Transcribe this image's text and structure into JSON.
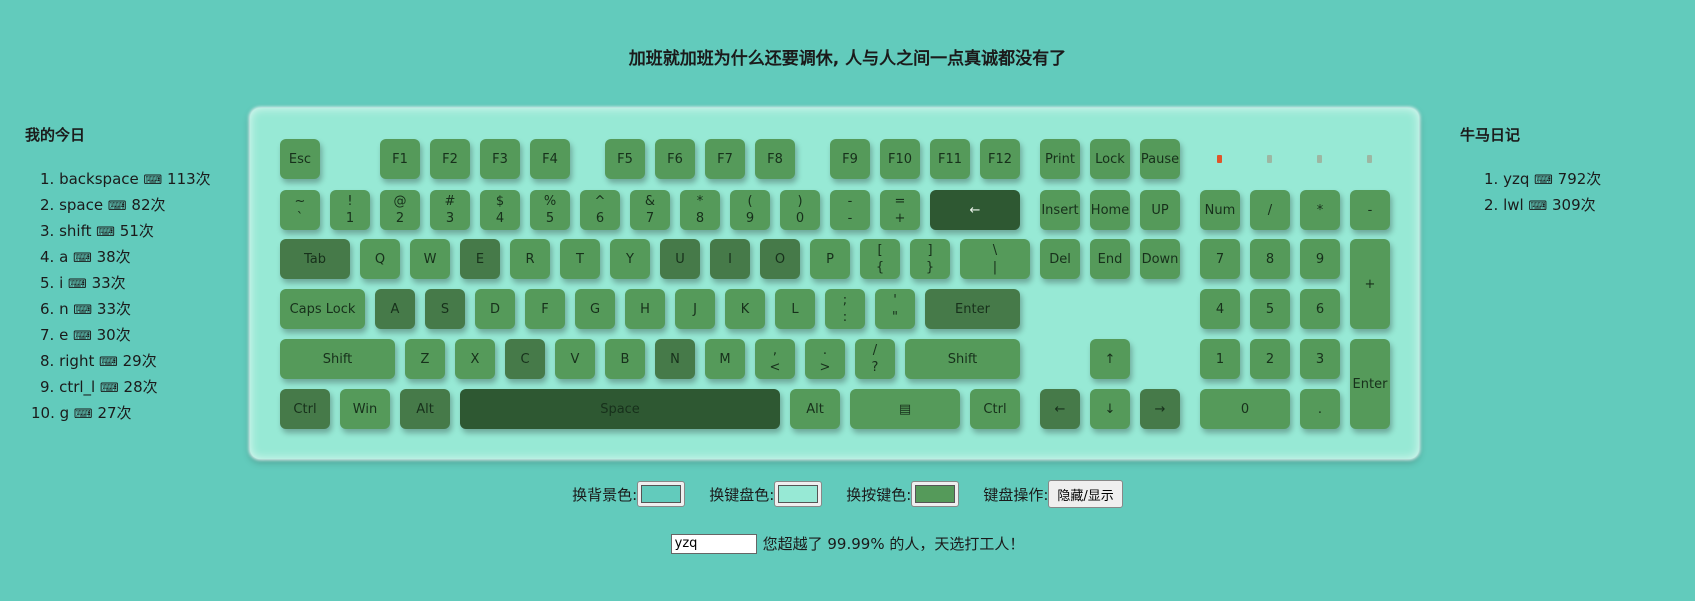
{
  "title": "加班就加班为什么还要调休, 人与人之间一点真诚都没有了",
  "left_panel": {
    "title": "我的今日",
    "items": [
      {
        "num": "1.",
        "key": "backspace",
        "count": "113次"
      },
      {
        "num": "2.",
        "key": "space",
        "count": "82次"
      },
      {
        "num": "3.",
        "key": "shift",
        "count": "51次"
      },
      {
        "num": "4.",
        "key": "a",
        "count": "38次"
      },
      {
        "num": "5.",
        "key": "i",
        "count": "33次"
      },
      {
        "num": "6.",
        "key": "n",
        "count": "33次"
      },
      {
        "num": "7.",
        "key": "e",
        "count": "30次"
      },
      {
        "num": "8.",
        "key": "right",
        "count": "29次"
      },
      {
        "num": "9.",
        "key": "ctrl_l",
        "count": "28次"
      },
      {
        "num": "10.",
        "key": "g",
        "count": "27次"
      }
    ]
  },
  "right_panel": {
    "title": "牛马日记",
    "items": [
      {
        "num": "1.",
        "key": "yzq",
        "count": "792次"
      },
      {
        "num": "2.",
        "key": "lwl",
        "count": "309次"
      }
    ]
  },
  "icons": {
    "keyboard": "⌨",
    "menu": "▤"
  },
  "keys": {
    "esc": "Esc",
    "f": [
      "F1",
      "F2",
      "F3",
      "F4",
      "F5",
      "F6",
      "F7",
      "F8",
      "F9",
      "F10",
      "F11",
      "F12"
    ],
    "print": "Print",
    "lock": "Lock",
    "pause": "Pause",
    "num_row_top": [
      "~",
      "!",
      "@",
      "#",
      "$",
      "%",
      "^",
      "&",
      "*",
      "(",
      ")",
      "-",
      "="
    ],
    "num_row_bottom": [
      "`",
      "1",
      "2",
      "3",
      "4",
      "5",
      "6",
      "7",
      "8",
      "9",
      "0",
      "-",
      "+"
    ],
    "backspace": "←",
    "insert": "Insert",
    "home": "Home",
    "up_page": "UP",
    "numlock": "Num",
    "num_div": "/",
    "num_mul": "*",
    "num_minus": "-",
    "tab": "Tab",
    "qrow": [
      "Q",
      "W",
      "E",
      "R",
      "T",
      "Y",
      "U",
      "I",
      "O",
      "P"
    ],
    "bracket_l_top": "[",
    "bracket_l_bottom": "{",
    "bracket_r_top": "]",
    "bracket_r_bottom": "}",
    "backslash_top": "\\",
    "backslash_bottom": "|",
    "del": "Del",
    "end": "End",
    "down_page": "Down",
    "num7": "7",
    "num8": "8",
    "num9": "9",
    "num_plus": "+",
    "caps": "Caps Lock",
    "arow": [
      "A",
      "S",
      "D",
      "F",
      "G",
      "H",
      "J",
      "K",
      "L"
    ],
    "semi_top": ";",
    "semi_bottom": ":",
    "quote_top": "'",
    "quote_bottom": "\"",
    "enter": "Enter",
    "num4": "4",
    "num5": "5",
    "num6": "6",
    "shift": "Shift",
    "zrow": [
      "Z",
      "X",
      "C",
      "V",
      "B",
      "N",
      "M"
    ],
    "comma_top": ",",
    "comma_bottom": "<",
    "period_top": ".",
    "period_bottom": ">",
    "slash_top": "/",
    "slash_bottom": "?",
    "arrow_up": "↑",
    "num1": "1",
    "num2": "2",
    "num3": "3",
    "num_enter": "Enter",
    "ctrl": "Ctrl",
    "win": "Win",
    "alt": "Alt",
    "space": "Space",
    "arrow_left": "←",
    "arrow_down": "↓",
    "arrow_right": "→",
    "num0": "0",
    "num_dot": "."
  },
  "controls": {
    "bg_label": "换背景色:",
    "board_label": "换键盘色:",
    "key_label": "换按键色:",
    "op_label": "键盘操作:",
    "toggle_button": "隐藏/显示",
    "bg_color": "#62cbbc",
    "board_color": "#97e9d5",
    "key_color": "#559a5a"
  },
  "bottom": {
    "name_value": "yzq",
    "message": "您超越了 99.99% 的人，天选打工人！"
  }
}
